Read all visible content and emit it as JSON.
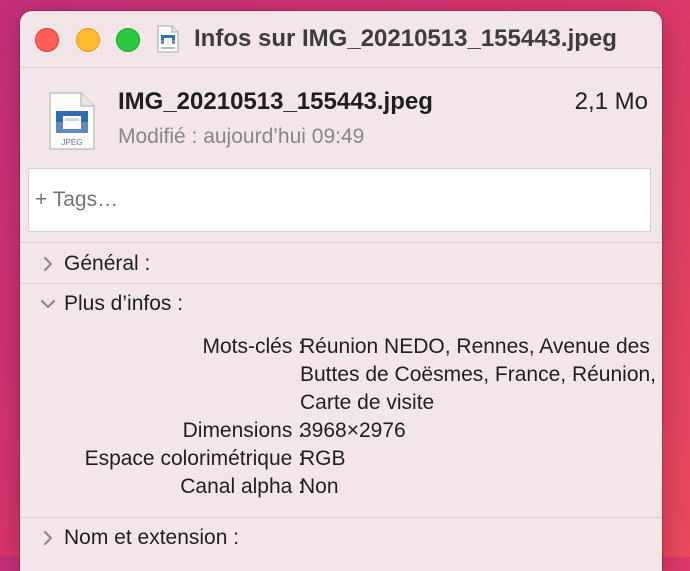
{
  "window": {
    "title": "Infos sur IMG_20210513_155443.jpeg"
  },
  "file": {
    "name": "IMG_20210513_155443.jpeg",
    "size": "2,1 Mo",
    "modified": "Modifié : aujourd’hui 09:49",
    "type_badge": "JPEG",
    "icon": "jpeg-file-icon"
  },
  "tags": {
    "placeholder": "+ Tags…"
  },
  "sections": {
    "general": {
      "label": "Général :",
      "expanded": false
    },
    "more_info": {
      "label": "Plus d’infos :",
      "expanded": true
    },
    "name_ext": {
      "label": "Nom et extension :",
      "expanded": false
    }
  },
  "more_info": {
    "rows": [
      {
        "key": "Mots-clés :",
        "value": "Réunion NEDO, Rennes, Avenue des Buttes de Coësmes, France, Réunion, Carte de visite"
      },
      {
        "key": "Dimensions :",
        "value": "3968×2976"
      },
      {
        "key": "Espace colorimétrique :",
        "value": "RGB"
      },
      {
        "key": "Canal alpha :",
        "value": "Non"
      }
    ]
  },
  "colors": {
    "close": "#fe5f57",
    "minimize": "#febc2e",
    "maximize": "#28c840",
    "window_bg": "#f2e6e8"
  }
}
